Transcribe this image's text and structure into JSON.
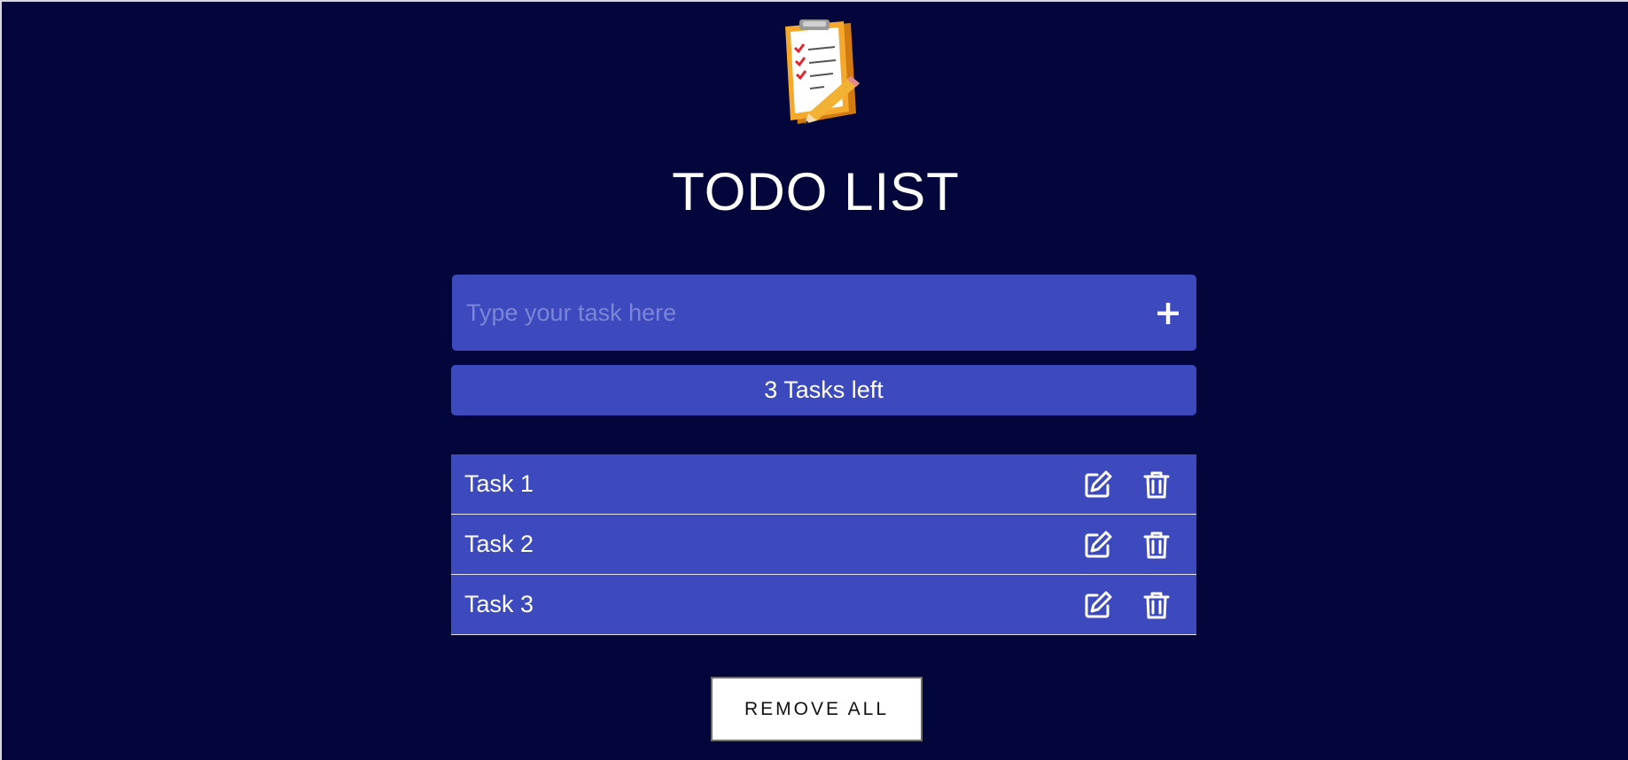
{
  "header": {
    "logo_icon": "clipboard-checklist-icon",
    "title": "TODO LIST"
  },
  "input": {
    "placeholder": "Type your task here",
    "value": "",
    "add_icon": "plus-icon",
    "add_label": "+"
  },
  "counter": {
    "text": "3 Tasks left"
  },
  "tasks": [
    {
      "label": "Task 1",
      "edit_icon": "edit-icon",
      "delete_icon": "trash-icon"
    },
    {
      "label": "Task 2",
      "edit_icon": "edit-icon",
      "delete_icon": "trash-icon"
    },
    {
      "label": "Task 3",
      "edit_icon": "edit-icon",
      "delete_icon": "trash-icon"
    }
  ],
  "actions": {
    "remove_all_label": "REMOVE ALL"
  },
  "colors": {
    "background": "#03063a",
    "panel": "#3d4abd",
    "placeholder": "#7b86d8",
    "text": "#ffffff"
  }
}
